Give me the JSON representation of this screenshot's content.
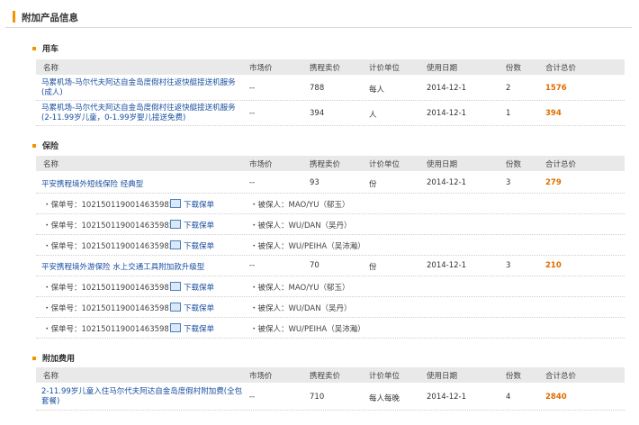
{
  "page_title": "附加产品信息",
  "columns": {
    "name": "名称",
    "market_price": "市场价",
    "price": "携程卖价",
    "unit": "计价单位",
    "date": "使用日期",
    "qty": "份数",
    "total": "合计总价"
  },
  "sections": {
    "car": {
      "title": "用车",
      "rows": [
        {
          "name_line1": "马累机场-马尔代夫阿达自金岛度假村往返快艇接送机服务",
          "name_line2": "(成人)",
          "market_price": "--",
          "price": "788",
          "unit": "每人",
          "date": "2014-12-1",
          "qty": "2",
          "total": "1576"
        },
        {
          "name_line1": "马累机场-马尔代夫阿达自金岛度假村往返快艇接送机服务",
          "name_line2": "(2-11.99岁儿童，0-1.99岁婴儿接送免费)",
          "market_price": "--",
          "price": "394",
          "unit": "人",
          "date": "2014-12-1",
          "qty": "1",
          "total": "394"
        }
      ]
    },
    "insurance": {
      "title": "保险",
      "products": [
        {
          "name": "平安携程境外短线保险 经典型",
          "market_price": "--",
          "price": "93",
          "unit": "份",
          "date": "2014-12-1",
          "qty": "3",
          "total": "279",
          "policies": [
            {
              "policy": "・保单号：10215011900146359858",
              "download": "下载保单",
              "insured": "・被保人：MAO/YU（郁玉）"
            },
            {
              "policy": "・保单号：10215011900146359859",
              "download": "下载保单",
              "insured": "・被保人：WU/DAN（吴丹）"
            },
            {
              "policy": "・保单号：10215011900146359857",
              "download": "下载保单",
              "insured": "・被保人：WU/PEIHA（吴沛瀚）"
            }
          ]
        },
        {
          "name": "平安携程境外游保险 水上交通工具附加款升级型",
          "market_price": "--",
          "price": "70",
          "unit": "份",
          "date": "2014-12-1",
          "qty": "3",
          "total": "210",
          "policies": [
            {
              "policy": "・保单号：10215011900146359874",
              "download": "下载保单",
              "insured": "・被保人：MAO/YU（郁玉）"
            },
            {
              "policy": "・保单号：10215011900146359876",
              "download": "下载保单",
              "insured": "・被保人：WU/DAN（吴丹）"
            },
            {
              "policy": "・保单号：10215011900146359875",
              "download": "下载保单",
              "insured": "・被保人：WU/PEIHA（吴沛瀚）"
            }
          ]
        }
      ]
    },
    "extra": {
      "title": "附加费用",
      "rows": [
        {
          "name_line1": "2-11.99岁儿童入住马尔代夫阿达自金岛度假村附加费(全包",
          "name_line2": "套餐)",
          "market_price": "--",
          "price": "710",
          "unit": "每人每晚",
          "date": "2014-12-1",
          "qty": "4",
          "total": "2840"
        }
      ]
    }
  },
  "colors": {
    "accent": "#f29400",
    "link": "#1a4fa0",
    "total": "#e06c00",
    "header_bg": "#e9e9e9"
  },
  "icons": {
    "download": "download-document-icon",
    "section_marker": "orange-square-icon"
  }
}
